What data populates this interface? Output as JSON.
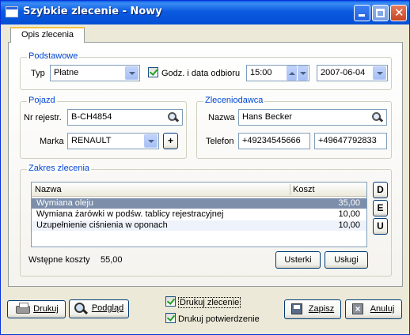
{
  "window": {
    "title": "Szybkie zlecenie - Nowy"
  },
  "tabs": [
    {
      "label": "Opis zlecenia"
    }
  ],
  "podstawowe": {
    "group_title": "Podstawowe",
    "typ_label": "Typ",
    "typ_value": "Płatne",
    "pickup_checkbox_label": "Godz. i data odbioru",
    "pickup_checked": true,
    "time_value": "15:00",
    "date_value": "2007-06-04"
  },
  "pojazd": {
    "group_title": "Pojazd",
    "nr_label": "Nr rejestr.",
    "nr_value": "B-CH4854",
    "marka_label": "Marka",
    "marka_value": "RENAULT",
    "add_button": "+"
  },
  "zleceniodawca": {
    "group_title": "Zleceniodawca",
    "nazwa_label": "Nazwa",
    "nazwa_value": "Hans Becker",
    "telefon_label": "Telefon",
    "telefon1": "+49234545666",
    "telefon2": "+49647792833"
  },
  "zakres": {
    "group_title": "Zakres zlecenia",
    "columns": [
      "Nazwa",
      "Koszt"
    ],
    "rows": [
      {
        "nazwa": "Wymiana oleju",
        "koszt": "35,00"
      },
      {
        "nazwa": "Wymiana żarówki w podśw. tablicy rejestracyjnej",
        "koszt": "10,00"
      },
      {
        "nazwa": "Uzupełnienie ciśnienia w oponach",
        "koszt": "10,00"
      }
    ],
    "side_buttons": [
      "D",
      "E",
      "U"
    ],
    "koszty_label": "Wstępne koszty",
    "koszty_value": "55,00",
    "usterki_button": "Usterki",
    "uslugi_button": "Usługi"
  },
  "footer": {
    "drukuj_button": "Drukuj",
    "podglad_button": "Podgląd",
    "drukuj_zlecenie_label": "Drukuj zlecenie",
    "drukuj_potwierdzenie_label": "Drukuj potwierdzenie",
    "zapisz_button": "Zapisz",
    "anuluj_button": "Anuluj"
  }
}
